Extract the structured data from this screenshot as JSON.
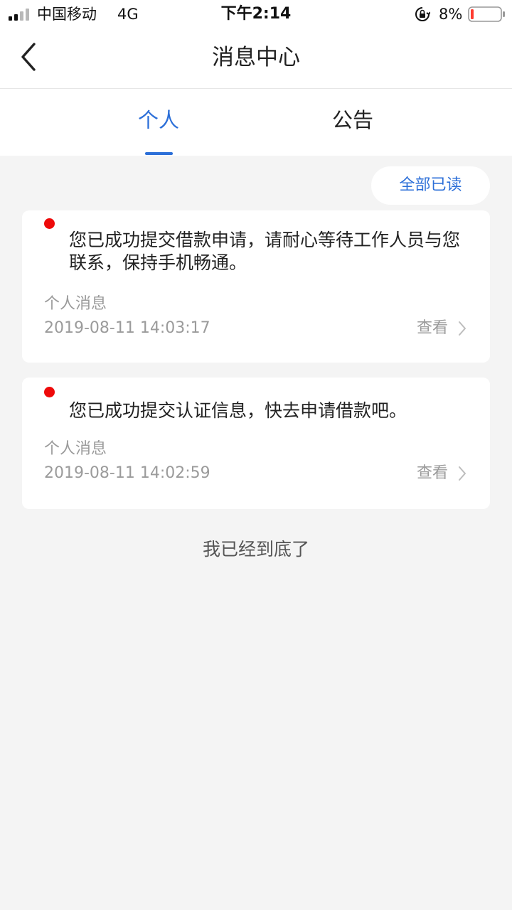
{
  "status_bar": {
    "carrier": "中国移动",
    "network": "4G",
    "time": "下午2:14",
    "battery": "8%",
    "icons": [
      "signal-icon",
      "orientation-lock-icon",
      "battery-icon"
    ]
  },
  "nav": {
    "title": "消息中心",
    "back_icon": "chevron-left-icon"
  },
  "tabs": [
    {
      "label": "个人",
      "active": true
    },
    {
      "label": "公告",
      "active": false
    }
  ],
  "mark_all_read": "全部已读",
  "messages": [
    {
      "unread": true,
      "text": "您已成功提交借款申请，请耐心等待工作人员与您联系，保持手机畅通。",
      "category": "个人消息",
      "time": "2019-08-11 14:03:17",
      "action": "查看"
    },
    {
      "unread": true,
      "text": "您已成功提交认证信息，快去申请借款吧。",
      "category": "个人消息",
      "time": "2019-08-11 14:02:59",
      "action": "查看"
    }
  ],
  "footer_note": "我已经到底了",
  "colors": {
    "accent": "#2c6fd8",
    "unread_dot": "#ee0a0a",
    "background": "#f4f4f4",
    "battery_low": "#ff3b30"
  }
}
